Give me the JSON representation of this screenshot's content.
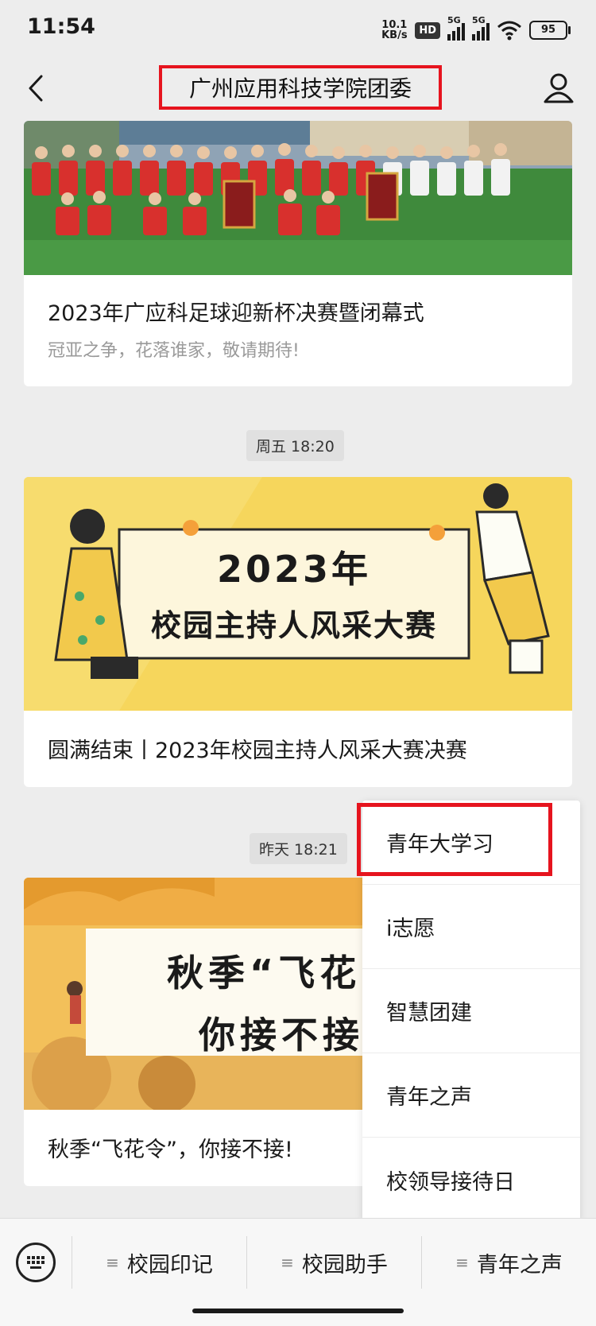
{
  "status": {
    "time": "11:54",
    "net_speed_top": "10.1",
    "net_speed_bottom": "KB/s",
    "hd": "HD",
    "sig1": "5G",
    "sig2": "5G",
    "battery": "95"
  },
  "nav": {
    "title": "广州应用科技学院团委"
  },
  "articles": [
    {
      "title": "2023年广应科足球迎新杯决赛暨闭幕式",
      "subtitle": "冠亚之争，花落谁家，敬请期待!"
    },
    {
      "time": "周五 18:20",
      "banner_line1": "2023年",
      "banner_line2": "校园主持人风采大赛",
      "title": "圆满结束丨2023年校园主持人风采大赛决赛"
    },
    {
      "time": "昨天 18:21",
      "banner_line1": "秋季“飞花",
      "banner_line2": "你接不接",
      "title": "秋季“飞花令”，你接不接!"
    }
  ],
  "popup_menu": {
    "items": [
      "青年大学习",
      "i志愿",
      "智慧团建",
      "青年之声",
      "校领导接待日"
    ]
  },
  "bottom_menu": {
    "tabs": [
      "校园印记",
      "校园助手",
      "青年之声"
    ]
  },
  "colors": {
    "highlight": "#e6141e",
    "background": "#ededed",
    "banner_yellow": "#f6d65c",
    "banner_orange": "#f2b94a"
  }
}
